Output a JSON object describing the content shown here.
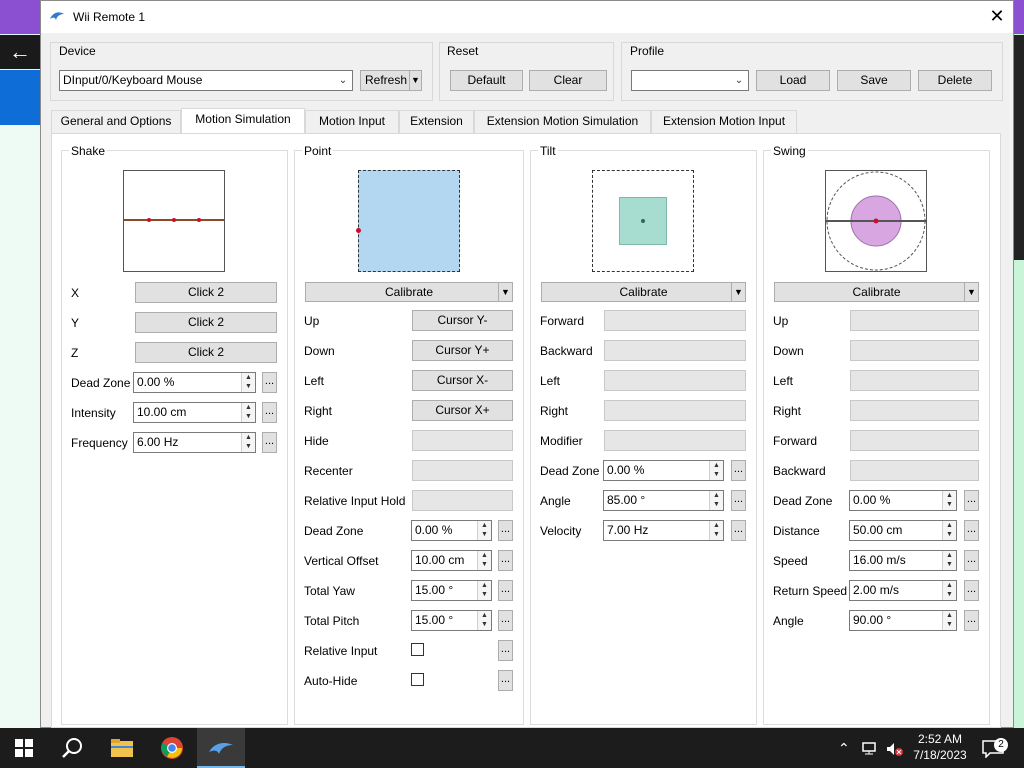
{
  "window": {
    "title": "Wii Remote 1"
  },
  "device": {
    "label": "Device",
    "value": "DInput/0/Keyboard Mouse",
    "refresh_label": "Refresh"
  },
  "reset": {
    "label": "Reset",
    "default_label": "Default",
    "clear_label": "Clear"
  },
  "profile": {
    "label": "Profile",
    "value": "",
    "load_label": "Load",
    "save_label": "Save",
    "delete_label": "Delete"
  },
  "tabs": [
    {
      "label": "General and Options",
      "active": false
    },
    {
      "label": "Motion Simulation",
      "active": true
    },
    {
      "label": "Motion Input",
      "active": false
    },
    {
      "label": "Extension",
      "active": false
    },
    {
      "label": "Extension Motion Simulation",
      "active": false
    },
    {
      "label": "Extension Motion Input",
      "active": false
    }
  ],
  "shake": {
    "title": "Shake",
    "rows": [
      {
        "label": "X",
        "value": "Click 2"
      },
      {
        "label": "Y",
        "value": "Click 2"
      },
      {
        "label": "Z",
        "value": "Click 2"
      }
    ],
    "settings": [
      {
        "label": "Dead Zone",
        "value": "0.00 %"
      },
      {
        "label": "Intensity",
        "value": "10.00 cm"
      },
      {
        "label": "Frequency",
        "value": "6.00 Hz"
      }
    ]
  },
  "point": {
    "title": "Point",
    "calibrate_label": "Calibrate",
    "rows": [
      {
        "label": "Up",
        "value": "Cursor Y-"
      },
      {
        "label": "Down",
        "value": "Cursor Y+"
      },
      {
        "label": "Left",
        "value": "Cursor X-"
      },
      {
        "label": "Right",
        "value": "Cursor X+"
      },
      {
        "label": "Hide",
        "value": ""
      },
      {
        "label": "Recenter",
        "value": ""
      },
      {
        "label": "Relative Input Hold",
        "value": ""
      }
    ],
    "settings": [
      {
        "label": "Dead Zone",
        "value": "0.00 %"
      },
      {
        "label": "Vertical Offset",
        "value": "10.00 cm"
      },
      {
        "label": "Total Yaw",
        "value": "15.00 °"
      },
      {
        "label": "Total Pitch",
        "value": "15.00 °"
      }
    ],
    "checks": [
      {
        "label": "Relative Input",
        "checked": false
      },
      {
        "label": "Auto-Hide",
        "checked": false
      }
    ]
  },
  "tilt": {
    "title": "Tilt",
    "calibrate_label": "Calibrate",
    "rows": [
      {
        "label": "Forward",
        "value": ""
      },
      {
        "label": "Backward",
        "value": ""
      },
      {
        "label": "Left",
        "value": ""
      },
      {
        "label": "Right",
        "value": ""
      },
      {
        "label": "Modifier",
        "value": ""
      }
    ],
    "settings": [
      {
        "label": "Dead Zone",
        "value": "0.00 %"
      },
      {
        "label": "Angle",
        "value": "85.00 °"
      },
      {
        "label": "Velocity",
        "value": "7.00 Hz"
      }
    ]
  },
  "swing": {
    "title": "Swing",
    "calibrate_label": "Calibrate",
    "rows": [
      {
        "label": "Up",
        "value": ""
      },
      {
        "label": "Down",
        "value": ""
      },
      {
        "label": "Left",
        "value": ""
      },
      {
        "label": "Right",
        "value": ""
      },
      {
        "label": "Forward",
        "value": ""
      },
      {
        "label": "Backward",
        "value": ""
      }
    ],
    "settings": [
      {
        "label": "Dead Zone",
        "value": "0.00 %"
      },
      {
        "label": "Distance",
        "value": "50.00 cm"
      },
      {
        "label": "Speed",
        "value": "16.00 m/s"
      },
      {
        "label": "Return Speed",
        "value": "2.00 m/s"
      },
      {
        "label": "Angle",
        "value": "90.00 °"
      }
    ]
  },
  "more_label": "...",
  "colors": {
    "point_fill": "#b3d7f0",
    "tilt_fill": "#a6ddd0",
    "swing_fill": "#d8a6e0",
    "marker": "#c8102e",
    "shake_line": "#8b4a2b"
  },
  "taskbar": {
    "time": "2:52 AM",
    "date": "7/18/2023",
    "notifications": "2",
    "icons": [
      "windows-icon",
      "search-icon",
      "file-explorer-icon",
      "chrome-icon",
      "dolphin-icon"
    ]
  }
}
